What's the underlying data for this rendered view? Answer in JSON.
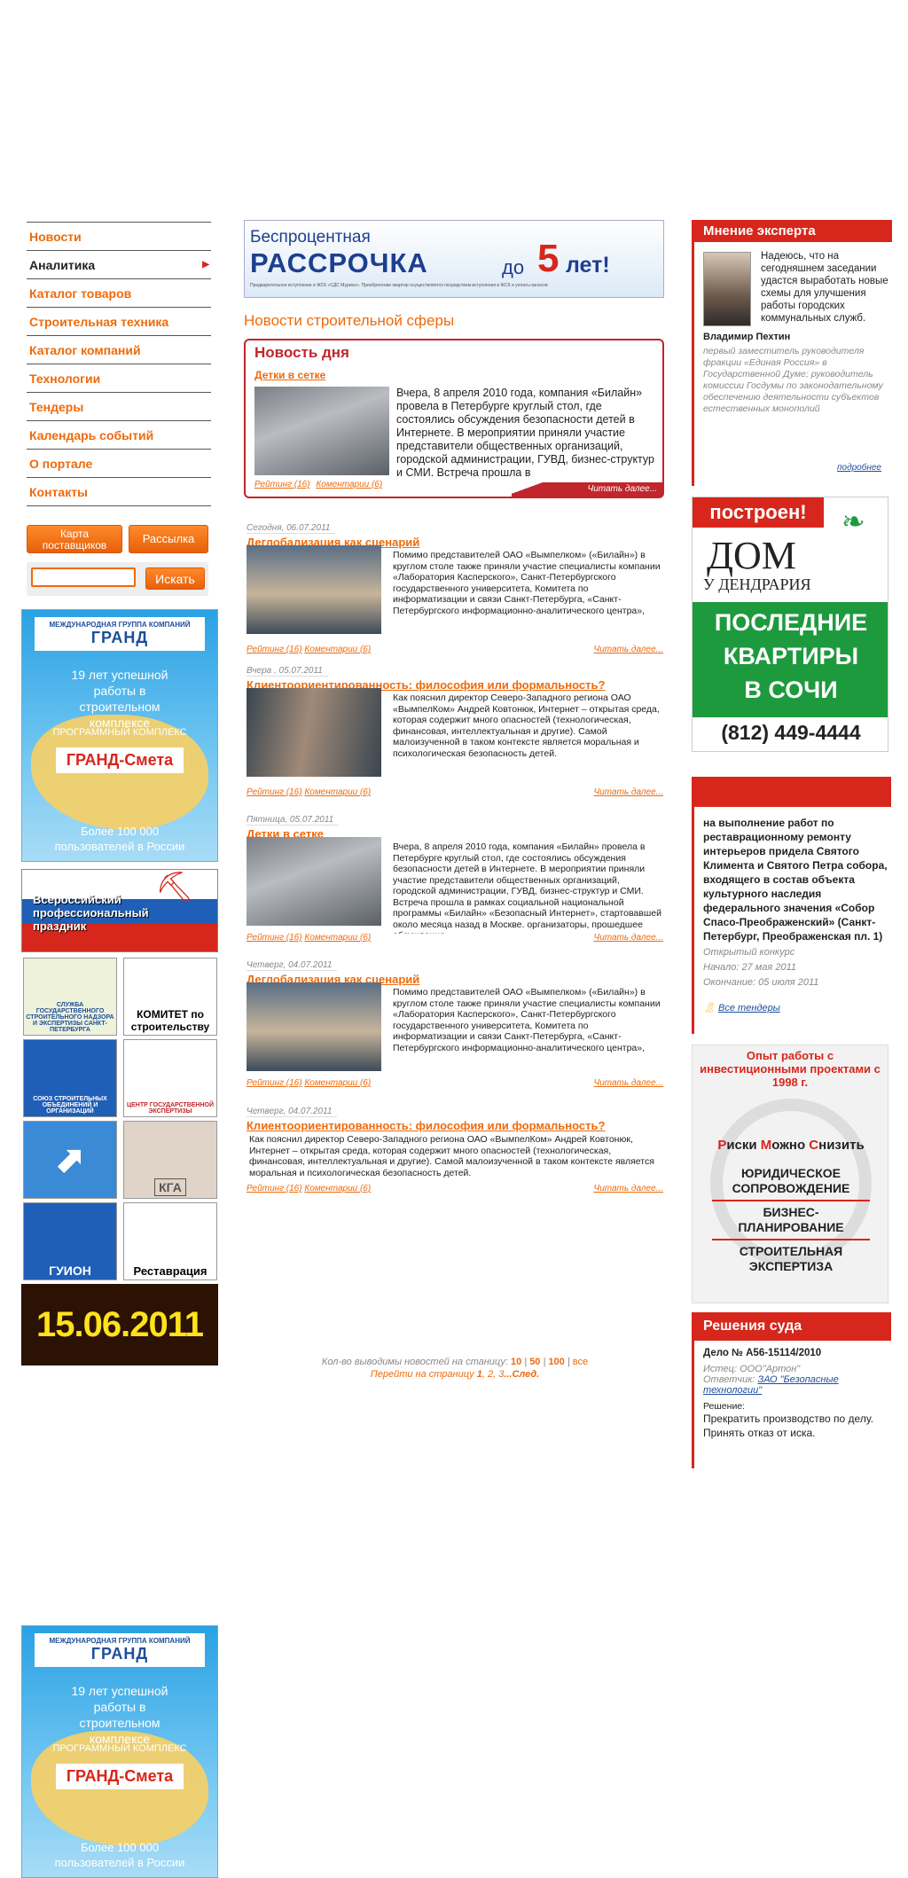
{
  "nav": {
    "items": [
      {
        "label": "Новости",
        "active": false
      },
      {
        "label": "Аналитика",
        "active": true
      },
      {
        "label": "Каталог товаров",
        "active": false
      },
      {
        "label": "Строительная техника",
        "active": false
      },
      {
        "label": "Каталог компаний",
        "active": false
      },
      {
        "label": "Технологии",
        "active": false
      },
      {
        "label": "Тендеры",
        "active": false
      },
      {
        "label": "Календарь событий",
        "active": false
      },
      {
        "label": "О портале",
        "active": false
      },
      {
        "label": "Контакты",
        "active": false
      }
    ]
  },
  "left": {
    "btn_map": "Карта поставщиков",
    "btn_mail": "Рассылка",
    "search_btn": "Искать",
    "search_value": "",
    "grand": {
      "brand_small": "МЕЖДУНАРОДНАЯ ГРУППА КОМПАНИЙ",
      "brand": "ГРАНД",
      "years": "19 лет успешной работы в строительном комплексе",
      "prog": "ПРОГРАММНЫЙ КОМПЛЕКС",
      "smeta": "ГРАНД-Смета",
      "users": "Более 100 000 пользователей в России"
    },
    "holiday": "Всероссийский профессиональный праздник",
    "logos": [
      "СЛУЖБА ГОСУДАРСТВЕННОГО СТРОИТЕЛЬНОГО НАДЗОРА И ЭКСПЕРТИЗЫ САНКТ-ПЕТЕРБУРГА",
      "КОМИТЕТ по строительству",
      "СОЮЗ СТРОИТЕЛЬНЫХ ОБЪЕДИНЕНИЙ И ОРГАНИЗАЦИЙ",
      "ЦЕНТР ГОСУДАРСТВЕННОЙ ЭКСПЕРТИЗЫ",
      "",
      "КГА",
      "ГУИОН",
      "Реставрация"
    ],
    "date_banner": "15.06.2011"
  },
  "promo": {
    "line1": "Беспроцентная",
    "line2": "РАССРОЧКА",
    "line3": "до",
    "num": "5",
    "line4": "лет!",
    "fine": "Предварительное вступление в ЖСК «СДС Мурино». Приобретение квартир осуществляется посредством вступления в ЖСК и уплаты взносов"
  },
  "center": {
    "section_title": "Новости строительной сферы",
    "day": {
      "title": "Новость дня",
      "link": "Детки в сетке",
      "text": "Вчера, 8 апреля 2010 года, компания «Билайн» провела в Петербурге круглый стол, где состоялись обсуждения безопасности детей в Интернете. В мероприятии приняли участие представители общественных организаций, городской администрации, ГУВД, бизнес-структур и СМИ. Встреча прошла в",
      "rating": "Рейтинг (16)",
      "comments": "Коментарии (6)",
      "more": "Читать далее..."
    },
    "news": [
      {
        "date": "Сегодня, 06.07.2011",
        "title": "Деглобализация как сценарий",
        "text": "Помимо представителей ОАО «Вымпелком» («Билайн») в круглом столе также приняли участие специалисты компании «Лаборатория Касперского», Санкт-Петербургского государственного университета, Комитета по информатизации и связи Санкт-Петербурга, «Санкт-Петербургского информационно-аналитического центра»,",
        "rating": "Рейтинг (16)",
        "comments": "Коментарии (6)",
        "more": "Читать далее..."
      },
      {
        "date": "Вчера , 05.07.2011",
        "title": "Клиентоориентированность: философия или формальность?",
        "text": "Как пояснил директор Северо-Западного региона ОАО «ВымпелКом» Андрей Ковтонюк, Интернет – открытая среда, которая содержит много опасностей (технологическая, финансовая, интеллектуальная и другие). Самой малоизученной в таком контексте является моральная и психологическая безопасность детей.",
        "rating": "Рейтинг (16)",
        "comments": "Коментарии (6)",
        "more": "Читать далее..."
      },
      {
        "date": "Пятница, 05.07.2011",
        "title": "Детки в сетке",
        "text": "Вчера, 8 апреля 2010 года, компания «Билайн» провела в Петербурге круглый стол, где состоялись обсуждения безопасности детей в Интернете. В мероприятии приняли участие представители общественных организаций, городской администрации, ГУВД, бизнес-структур и СМИ. Встреча прошла в рамках социальной национальной программы «Билайн» «Безопасный Интернет», стартовавшей около месяца назад в Москве. организаторы, прошедшее обсуждение",
        "rating": "Рейтинг (16)",
        "comments": "Коментарии (6)",
        "more": "Читать далее..."
      },
      {
        "date": "Четверг, 04.07.2011",
        "title": "Деглобализация как сценарий",
        "text": "Помимо представителей ОАО «Вымпелком» («Билайн») в круглом столе также приняли участие специалисты компании «Лаборатория Касперского», Санкт-Петербургского государственного университета, Комитета по информатизации и связи Санкт-Петербурга, «Санкт-Петербургского информационно-аналитического центра»,",
        "rating": "Рейтинг (16)",
        "comments": "Коментарии (6)",
        "more": "Читать далее..."
      },
      {
        "date": "Четверг, 04.07.2011",
        "title": "Клиентоориентированность: философия или формальность?",
        "text": "Как пояснил директор Северо-Западного региона ОАО «ВымпелКом» Андрей Ковтонюк, Интернет – открытая среда, которая содержит много опасностей (технологическая, финансовая, интеллектуальная и другие). Самой малоизученной в таком контексте является моральная и психологическая безопасность детей.",
        "rating": "Рейтинг (16)",
        "comments": "Коментарии (6)",
        "more": "Читать далее..."
      }
    ],
    "pager": {
      "count_label": "Кол-во выводимы новостей на станицу:",
      "opt10": "10",
      "opt50": "50",
      "opt100": "100",
      "opt_all": "все",
      "goto_label": "Перейти на страницу",
      "p1": "1",
      "p2": "2",
      "p3": "3",
      "next": "...След."
    }
  },
  "right": {
    "expert": {
      "title": "Мнение эксперта",
      "quote": "Надеюсь, что на сегодняшнем заседании удастся выработать новые схемы для улучшения работы городских коммунальных служб.",
      "name": "Владимир Пехтин",
      "position": "первый заместитель руководителя фракции «Единая Россия» в Государственной Думе; руководитель комиссии Госдумы по законодательному обеспечению деятельности субъектов естественных монополий",
      "more": "подробнее"
    },
    "dom": {
      "built": "построен!",
      "name1": "ДОМ",
      "name2": "У ДЕНДРАРИЯ",
      "line1": "ПОСЛЕДНИЕ",
      "line2": "КВАРТИРЫ",
      "line3": "В СОЧИ",
      "phone": "(812) 449-4444"
    },
    "tender": {
      "title": "на выполнение работ по реставрационному ремонту интерьеров придела Святого Климента и Святого Петра собора, входящего в состав объекта культурного наследия федерального значения «Собор Спасо-Преображенский» (Санкт-Петербург, Преображенская пл. 1)",
      "type": "Открытый конкурс",
      "start": "Начало: 27 мая 2011",
      "end": "Окончание: 05 июля 2011",
      "all": "Все тендеры"
    },
    "rms": {
      "head": "Опыт работы с инвестиционными проектами с 1998 г.",
      "r": "Р",
      "r_rest": "иски ",
      "m": "М",
      "m_rest": "ожно ",
      "s": "С",
      "s_rest": "низить",
      "l1": "ЮРИДИЧЕСКОЕ СОПРОВОЖДЕНИЕ",
      "l2": "БИЗНЕС-ПЛАНИРОВАНИЕ",
      "l3": "СТРОИТЕЛЬНАЯ ЭКСПЕРТИЗА"
    },
    "court": {
      "title": "Решения суда",
      "case": "Дело № А56-15114/2010",
      "plaintiff_label": "Истец:",
      "plaintiff": "ООО\"Артон\"",
      "defendant_label": "Ответчик:",
      "defendant": "ЗАО \"Безопасные технологии\"",
      "decision_label": "Решение:",
      "decision": "Прекратить производство по делу. Принять отказ от иска."
    }
  }
}
